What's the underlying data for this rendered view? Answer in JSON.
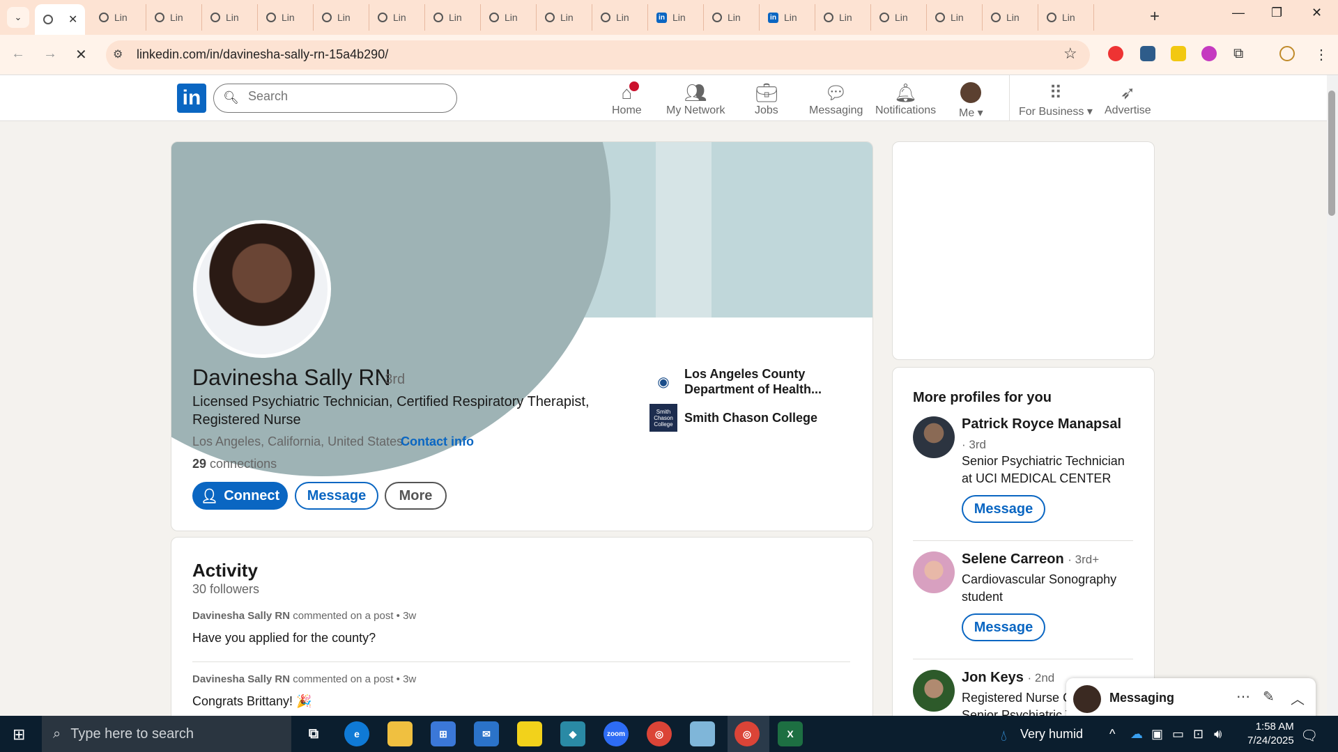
{
  "browser": {
    "tab_label": "Lin",
    "tab_count": 19,
    "url": "linkedin.com/in/davinesha-sally-rn-15a4b290/"
  },
  "header": {
    "logo": "in",
    "search_placeholder": "Search",
    "nav": [
      {
        "label": "Home",
        "icon": "home-icon"
      },
      {
        "label": "My Network",
        "icon": "network-icon"
      },
      {
        "label": "Jobs",
        "icon": "briefcase-icon"
      },
      {
        "label": "Messaging",
        "icon": "chat-icon"
      },
      {
        "label": "Notifications",
        "icon": "bell-icon"
      },
      {
        "label": "Me",
        "icon": "avatar"
      },
      {
        "label": "For Business",
        "icon": "grid-icon"
      },
      {
        "label": "Advertise",
        "icon": "compass-icon"
      }
    ]
  },
  "profile": {
    "name": "Davinesha Sally RN",
    "degree": "· 3rd",
    "headline": "Licensed Psychiatric Technician, Certified Respiratory Therapist, Registered Nurse",
    "location": "Los Angeles, California, United States",
    "location_sep": " · ",
    "contact_info": "Contact info",
    "connections_count": "29",
    "connections_label": " connections",
    "buttons": {
      "connect": "Connect",
      "message": "Message",
      "more": "More"
    },
    "orgs": [
      {
        "name": "Los Angeles County Department of Health..."
      },
      {
        "name": "Smith Chason College",
        "logo_text": "Smith Chason College"
      }
    ]
  },
  "activity": {
    "title": "Activity",
    "followers": "30 followers",
    "items": [
      {
        "author": "Davinesha Sally RN",
        "meta": " commented on a post • 3w",
        "text": "Have you applied for the county?"
      },
      {
        "author": "Davinesha Sally RN",
        "meta": " commented on a post • 3w",
        "text": "Congrats Brittany! 🎉"
      }
    ]
  },
  "more_profiles": {
    "title": "More profiles for you",
    "items": [
      {
        "name": "Patrick Royce Manapsal",
        "degree": "· 3rd",
        "headline": "Senior Psychiatric Technician at UCI MEDICAL CENTER",
        "button": "Message"
      },
      {
        "name": "Selene Carreon",
        "degree": "· 3rd+",
        "headline": "Cardiovascular Sonography student",
        "button": "Message"
      },
      {
        "name": "Jon Keys",
        "degree": "· 2nd",
        "headline": "Registered Nurse G",
        "headline2": "Senior Psychiatric T"
      }
    ]
  },
  "messaging": {
    "title": "Messaging"
  },
  "taskbar": {
    "search_placeholder": "Type here to search",
    "weather": "Very humid",
    "time": "1:58 AM",
    "date": "7/24/2025"
  },
  "colors": {
    "brand": "#0a66c2",
    "notification": "#cb112d",
    "tabstrip": "#fde3d3"
  }
}
